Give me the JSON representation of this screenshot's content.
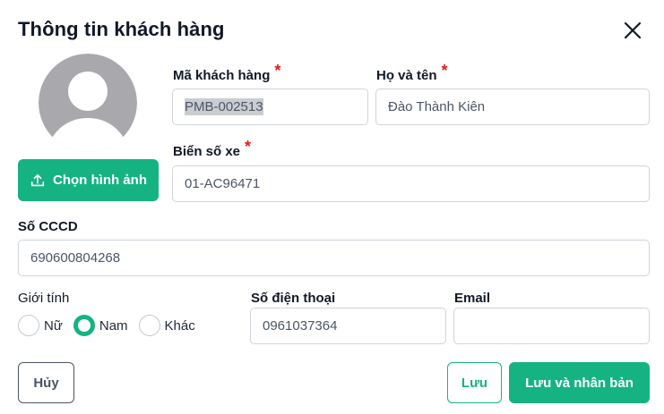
{
  "dialog": {
    "title": "Thông tin khách hàng"
  },
  "avatar": {
    "upload_label": "Chọn hình ảnh"
  },
  "fields": {
    "customer_code": {
      "label": "Mã khách hàng",
      "required_mark": "*",
      "value": "PMB-002513"
    },
    "full_name": {
      "label": "Họ và tên",
      "required_mark": "*",
      "value": "Đào Thành Kiên"
    },
    "plate": {
      "label": "Biển số xe",
      "required_mark": "*",
      "value": "01-AC96471"
    },
    "id_card": {
      "label": "Số CCCD",
      "value": "690600804268"
    },
    "gender": {
      "label": "Giới tính",
      "options": [
        {
          "label": "Nữ",
          "checked": false
        },
        {
          "label": "Nam",
          "checked": true
        },
        {
          "label": "Khác",
          "checked": false
        }
      ]
    },
    "phone": {
      "label": "Số điện thoại",
      "value": "0961037364"
    },
    "email": {
      "label": "Email",
      "value": ""
    }
  },
  "actions": {
    "cancel": "Hủy",
    "save": "Lưu",
    "save_duplicate": "Lưu và nhân bản"
  },
  "colors": {
    "accent": "#15b382",
    "required": "#e11d1d"
  }
}
